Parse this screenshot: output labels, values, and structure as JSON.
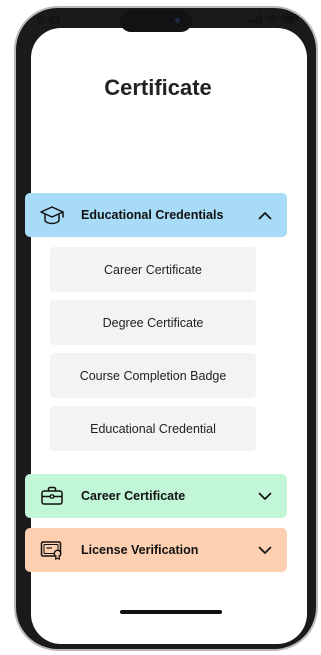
{
  "status_bar": {
    "time": "9:41"
  },
  "page": {
    "title": "Certificate"
  },
  "sections": [
    {
      "label": "Educational Credentials",
      "icon": "graduation-cap-icon",
      "color": "#a8dbf7",
      "expanded": true,
      "chevron": "chevron-up-icon",
      "items": [
        "Career Certificate",
        "Degree Certificate",
        "Course Completion Badge",
        "Educational Credential"
      ]
    },
    {
      "label": "Career Certificate",
      "icon": "briefcase-icon",
      "color": "#c1f6d6",
      "expanded": false,
      "chevron": "chevron-down-icon"
    },
    {
      "label": "License Verification",
      "icon": "certificate-icon",
      "color": "#fecfb1",
      "expanded": false,
      "chevron": "chevron-down-icon"
    }
  ]
}
